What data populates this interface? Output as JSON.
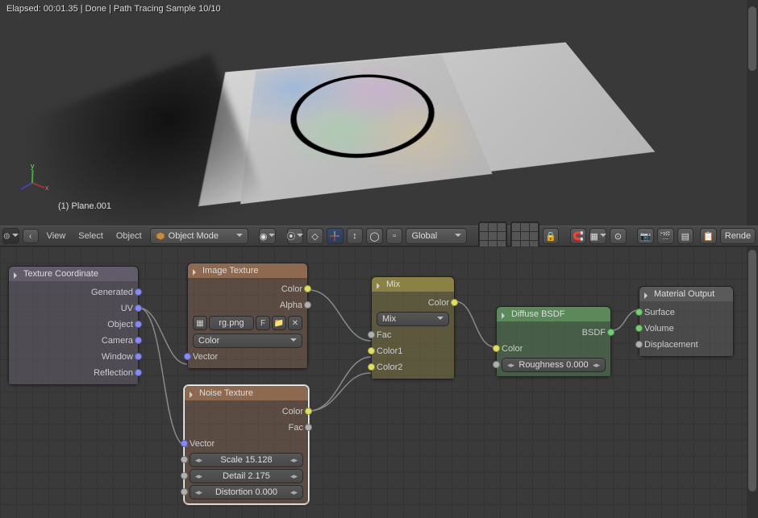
{
  "status": {
    "text": "Elapsed: 00:01.35 | Done | Path Tracing Sample 10/10"
  },
  "viewport": {
    "object_label": "(1) Plane.001",
    "axes": {
      "x": "x",
      "y": "y",
      "z": ""
    }
  },
  "header3d": {
    "menus": {
      "view": "View",
      "select": "Select",
      "object": "Object"
    },
    "mode_label": "Object Mode",
    "orientation": "Global",
    "render_btn": "Rende"
  },
  "nodes": {
    "texcoord": {
      "title": "Texture Coordinate",
      "outs": [
        "Generated",
        "UV",
        "Object",
        "Camera",
        "Window",
        "Reflection"
      ]
    },
    "imgtex": {
      "title": "Image Texture",
      "outs": [
        "Color",
        "Alpha"
      ],
      "file": "rg.png",
      "file_f": "F",
      "colorspace": "Color",
      "in_vector": "Vector"
    },
    "noise": {
      "title": "Noise Texture",
      "outs": [
        "Color",
        "Fac"
      ],
      "in_vector": "Vector",
      "scale_lbl": "Scale 15.128",
      "detail_lbl": "Detail 2.175",
      "distortion_lbl": "Distortion 0.000"
    },
    "mix": {
      "title": "Mix",
      "out": "Color",
      "mode": "Mix",
      "fac": "Fac",
      "c1": "Color1",
      "c2": "Color2"
    },
    "diffuse": {
      "title": "Diffuse BSDF",
      "out": "BSDF",
      "in_color": "Color",
      "roughness": "Roughness 0.000"
    },
    "matout": {
      "title": "Material Output",
      "ins": [
        "Surface",
        "Volume",
        "Displacement"
      ]
    }
  }
}
